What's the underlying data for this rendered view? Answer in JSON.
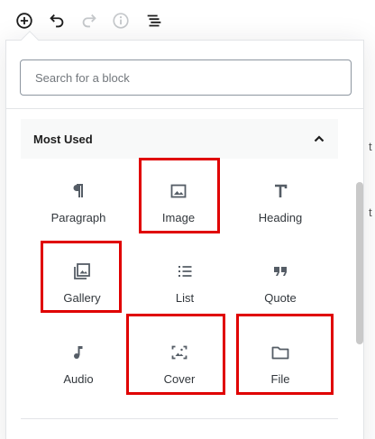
{
  "toolbar": {
    "buttons": [
      {
        "name": "add-block",
        "icon": "plus-circle-icon",
        "enabled": true
      },
      {
        "name": "undo",
        "icon": "undo-icon",
        "enabled": true
      },
      {
        "name": "redo",
        "icon": "redo-icon",
        "enabled": false
      },
      {
        "name": "info",
        "icon": "info-icon",
        "enabled": false
      },
      {
        "name": "outline",
        "icon": "list-view-icon",
        "enabled": true
      }
    ]
  },
  "inserter": {
    "search": {
      "placeholder": "Search for a block",
      "value": ""
    },
    "section": {
      "title": "Most Used",
      "expanded": true,
      "toggle_icon": "chevron-up-icon"
    },
    "blocks": [
      {
        "label": "Paragraph",
        "icon": "paragraph-icon",
        "highlighted": false
      },
      {
        "label": "Image",
        "icon": "image-icon",
        "highlighted": true
      },
      {
        "label": "Heading",
        "icon": "heading-icon",
        "highlighted": false
      },
      {
        "label": "Gallery",
        "icon": "gallery-icon",
        "highlighted": true
      },
      {
        "label": "List",
        "icon": "list-icon",
        "highlighted": false
      },
      {
        "label": "Quote",
        "icon": "quote-icon",
        "highlighted": false
      },
      {
        "label": "Audio",
        "icon": "audio-icon",
        "highlighted": false
      },
      {
        "label": "Cover",
        "icon": "cover-icon",
        "highlighted": true
      },
      {
        "label": "File",
        "icon": "file-icon",
        "highlighted": true
      }
    ]
  },
  "background": {
    "partial_text_1": "t",
    "partial_text_2": "t"
  },
  "colors": {
    "highlight": "#e00000",
    "icon": "#555d66",
    "text": "#1e1e1e",
    "panel_bg": "#f8f9f9"
  }
}
